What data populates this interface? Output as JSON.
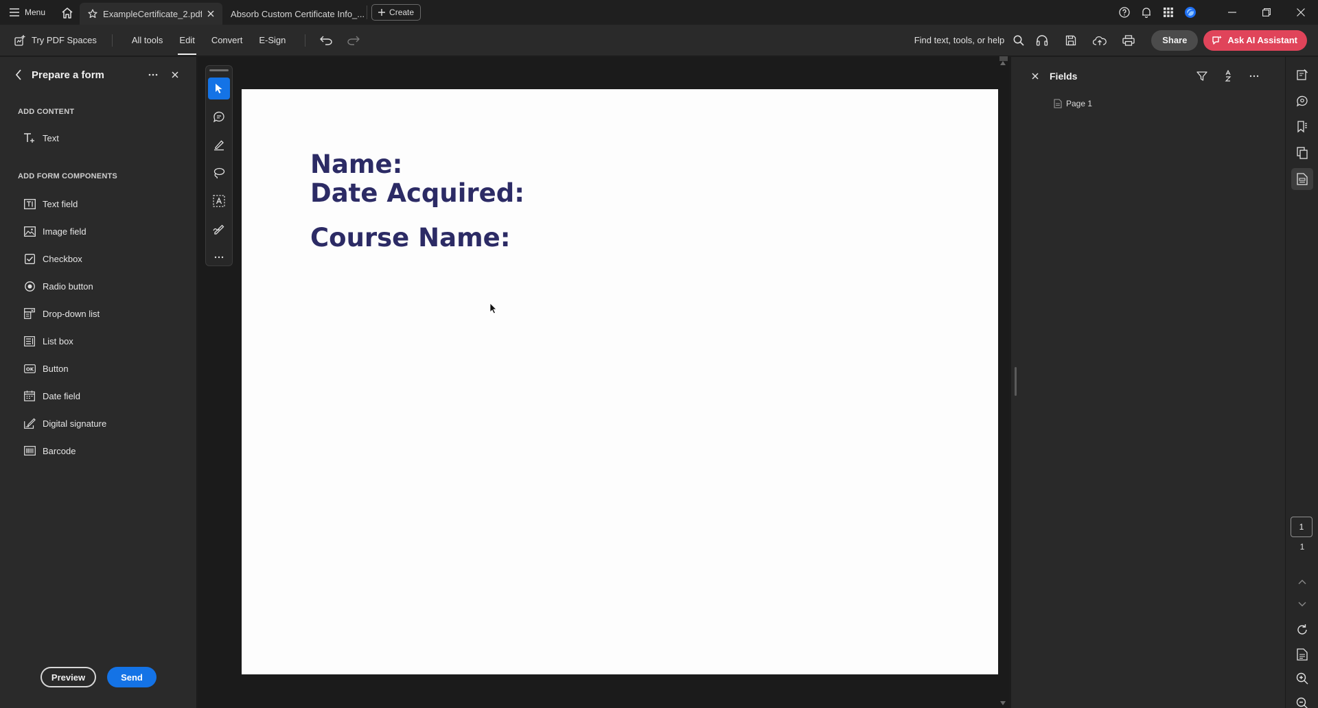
{
  "titlebar": {
    "menu_label": "Menu",
    "tabs": [
      {
        "label": "ExampleCertificate_2.pdf"
      },
      {
        "label": "Absorb Custom Certificate Info_..."
      }
    ],
    "create_label": "Create"
  },
  "toolbar": {
    "pdf_spaces_label": "Try PDF Spaces",
    "menu_tabs": [
      "All tools",
      "Edit",
      "Convert",
      "E-Sign"
    ],
    "active_tab": "Edit",
    "find_label": "Find text, tools, or help",
    "share_label": "Share",
    "ai_label": "Ask AI Assistant"
  },
  "left_panel": {
    "title": "Prepare a form",
    "section_content": "ADD CONTENT",
    "content_items": [
      {
        "label": "Text",
        "icon": "add-text-icon"
      }
    ],
    "section_components": "ADD FORM COMPONENTS",
    "component_items": [
      {
        "label": "Text field",
        "icon": "text-field-icon"
      },
      {
        "label": "Image field",
        "icon": "image-field-icon"
      },
      {
        "label": "Checkbox",
        "icon": "checkbox-icon"
      },
      {
        "label": "Radio button",
        "icon": "radio-button-icon"
      },
      {
        "label": "Drop-down list",
        "icon": "dropdown-list-icon"
      },
      {
        "label": "List box",
        "icon": "list-box-icon"
      },
      {
        "label": "Button",
        "icon": "ok-button-icon"
      },
      {
        "label": "Date field",
        "icon": "date-field-icon"
      },
      {
        "label": "Digital signature",
        "icon": "digital-signature-icon"
      },
      {
        "label": "Barcode",
        "icon": "barcode-icon"
      }
    ],
    "preview_label": "Preview",
    "send_label": "Send"
  },
  "document": {
    "lines": [
      "Name:",
      "Date Acquired:",
      "Course Name:"
    ],
    "text_color": "#2c2b65"
  },
  "fields_panel": {
    "title": "Fields",
    "tree": [
      {
        "label": "Page 1"
      }
    ]
  },
  "right_rail": {
    "current_page": "1",
    "total_pages": "1"
  },
  "colors": {
    "accent": "#1473e6",
    "ai_button": "#e0445a"
  }
}
